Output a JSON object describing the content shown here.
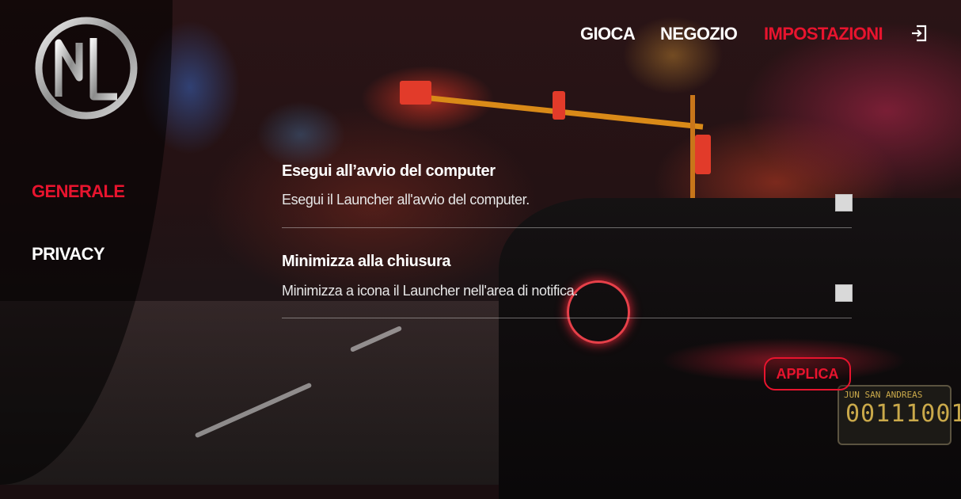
{
  "app": {
    "logo_text": "NL"
  },
  "top_nav": {
    "items": [
      {
        "label": "GIOCA",
        "active": false
      },
      {
        "label": "NEGOZIO",
        "active": false
      },
      {
        "label": "IMPOSTAZIONI",
        "active": true
      }
    ],
    "logout_icon": "logout-icon"
  },
  "sidebar": {
    "items": [
      {
        "label": "GENERALE",
        "active": true
      },
      {
        "label": "PRIVACY",
        "active": false
      }
    ]
  },
  "settings": [
    {
      "title": "Esegui all’avvio del computer",
      "description": "Esegui il Launcher all'avvio del computer.",
      "checked": false
    },
    {
      "title": "Minimizza alla chiusura",
      "description": "Minimizza a icona il Launcher nell'area di notifica.",
      "checked": false
    }
  ],
  "apply_label": "APPLICA",
  "background": {
    "plate_top": "JUN SAN ANDREAS",
    "plate_number": "00111001"
  },
  "colors": {
    "accent": "#e8142e",
    "text": "#ffffff",
    "checkbox": "#d9d9d9"
  }
}
